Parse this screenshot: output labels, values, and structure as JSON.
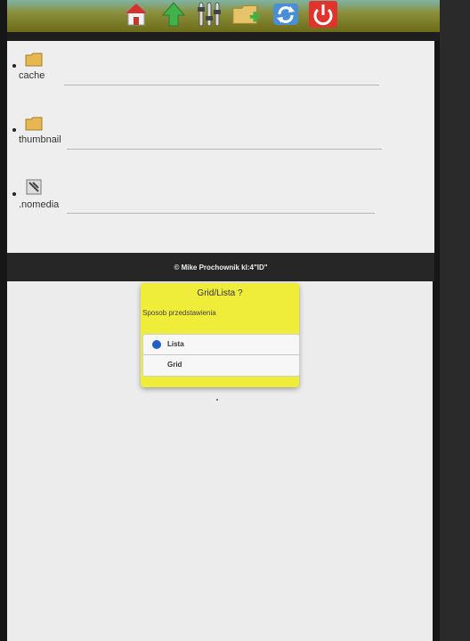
{
  "toolbar": {
    "buttons": [
      {
        "name": "home-icon",
        "icon": "house-icon"
      },
      {
        "name": "up-icon",
        "icon": "arrow-up-icon"
      },
      {
        "name": "settings-icon",
        "icon": "sliders-icon"
      },
      {
        "name": "newfolder-icon",
        "icon": "new-folder-icon"
      },
      {
        "name": "refresh-icon",
        "icon": "refresh-icon"
      },
      {
        "name": "power-icon",
        "icon": "power-icon"
      }
    ]
  },
  "files": [
    {
      "label": "cache",
      "icon": "folder-icon"
    },
    {
      "label": "thumbnail",
      "icon": "folder-icon"
    },
    {
      "label": ".nomedia",
      "icon": "file-icon"
    }
  ],
  "footer": {
    "text": "© Mike Prochownik kl:4\"ID\""
  },
  "dialog": {
    "title": "Grid/Lista ?",
    "message": "Sposob przedstawienia",
    "options": [
      {
        "label": "Lista",
        "selected": true
      },
      {
        "label": "Grid",
        "selected": false
      }
    ]
  },
  "colors": {
    "dialog_bg": "#f0ec3a",
    "radio_selected": "#1e5fc2",
    "power_red": "#e0332c"
  }
}
